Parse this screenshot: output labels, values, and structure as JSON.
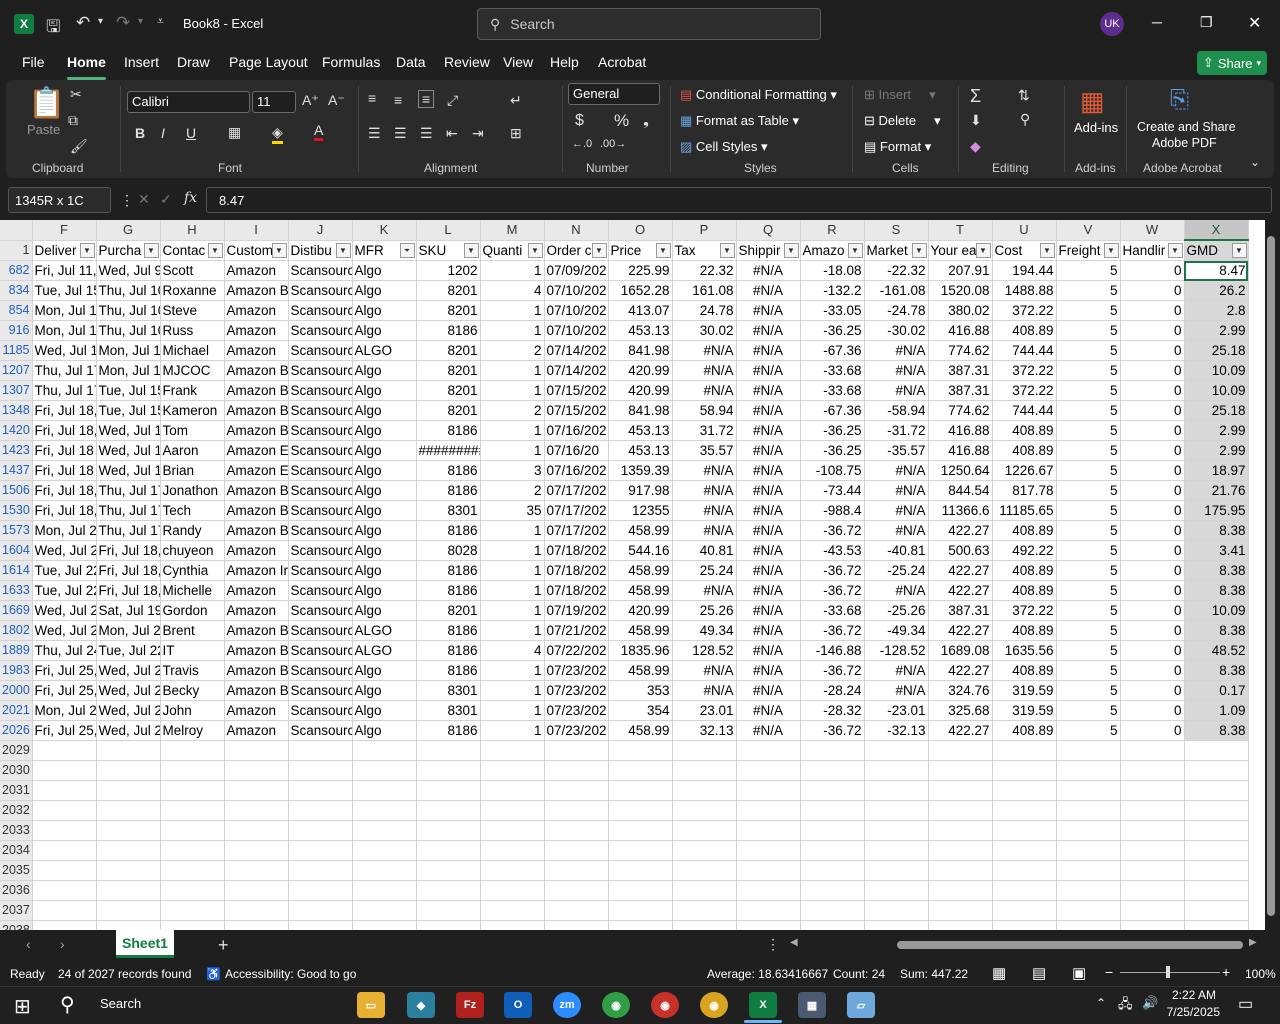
{
  "window": {
    "title": "Book8  -  Excel",
    "search_placeholder": "Search",
    "user_initials": "UK",
    "min": "─",
    "max": "❐",
    "close": "✕"
  },
  "menu": {
    "items": [
      "File",
      "Home",
      "Insert",
      "Draw",
      "Page Layout",
      "Formulas",
      "Data",
      "Review",
      "View",
      "Help",
      "Acrobat"
    ],
    "share": "Share"
  },
  "ribbon": {
    "clipboard": {
      "label": "Clipboard",
      "paste": "Paste"
    },
    "font": {
      "label": "Font",
      "name": "Calibri",
      "size": "11"
    },
    "alignment": {
      "label": "Alignment"
    },
    "number": {
      "label": "Number",
      "format": "General"
    },
    "styles": {
      "label": "Styles",
      "conditional": "Conditional Formatting",
      "format_table": "Format as Table",
      "cell_styles": "Cell Styles"
    },
    "cells": {
      "label": "Cells",
      "insert": "Insert",
      "delete": "Delete",
      "format": "Format"
    },
    "editing": {
      "label": "Editing"
    },
    "addins": {
      "label": "Add-ins",
      "button": "Add-ins"
    },
    "acrobat": {
      "label": "Adobe Acrobat",
      "button1": "Create and Share",
      "button2": "Adobe PDF"
    }
  },
  "formula_bar": {
    "name_box": "1345R x 1C",
    "value": "8.47"
  },
  "sheet": {
    "columns": [
      "F",
      "G",
      "H",
      "I",
      "J",
      "K",
      "L",
      "M",
      "N",
      "O",
      "P",
      "Q",
      "R",
      "S",
      "T",
      "U",
      "V",
      "W",
      "X"
    ],
    "headers": [
      "Deliver",
      "Purcha",
      "Contac",
      "Custom",
      "Distibu",
      "MFR",
      "SKU",
      "Quanti",
      "Order c",
      "Price",
      "Tax",
      "Shippir",
      "Amazo",
      "Market",
      "Your ea",
      "Cost",
      "Freight",
      "Handlir",
      "GMD"
    ],
    "rows": [
      [
        "682",
        "Fri, Jul 11,",
        "Wed, Jul 9",
        "Scott",
        "Amazon",
        "Scansourc",
        "Algo",
        "1202",
        "1",
        "07/09/202",
        "225.99",
        "22.32",
        "#N/A",
        "-18.08",
        "-22.32",
        "207.91",
        "194.44",
        "5",
        "0",
        "8.47"
      ],
      [
        "834",
        "Tue, Jul 15",
        "Thu, Jul 10",
        "Roxanne",
        "Amazon B",
        "Scansourc",
        "Algo",
        "8201",
        "4",
        "07/10/202",
        "1652.28",
        "161.08",
        "#N/A",
        "-132.2",
        "-161.08",
        "1520.08",
        "1488.88",
        "5",
        "0",
        "26.2"
      ],
      [
        "854",
        "Mon, Jul 1",
        "Thu, Jul 10",
        "Steve",
        "Amazon",
        "Scansourc",
        "Algo",
        "8201",
        "1",
        "07/10/202",
        "413.07",
        "24.78",
        "#N/A",
        "-33.05",
        "-24.78",
        "380.02",
        "372.22",
        "5",
        "0",
        "2.8"
      ],
      [
        "916",
        "Mon, Jul 1",
        "Thu, Jul 10",
        "Russ",
        "Amazon",
        "Scansourc",
        "Algo",
        "8186",
        "1",
        "07/10/202",
        "453.13",
        "30.02",
        "#N/A",
        "-36.25",
        "-30.02",
        "416.88",
        "408.89",
        "5",
        "0",
        "2.99"
      ],
      [
        "1185",
        "Wed, Jul 1",
        "Mon, Jul 1",
        "Michael",
        "Amazon",
        "Scansourc",
        "ALGO",
        "8201",
        "2",
        "07/14/202",
        "841.98",
        "#N/A",
        "#N/A",
        "-67.36",
        "#N/A",
        "774.62",
        "744.44",
        "5",
        "0",
        "25.18"
      ],
      [
        "1207",
        "Thu, Jul 17",
        "Mon, Jul 1",
        "MJCOC",
        "Amazon B",
        "Scansourc",
        "Algo",
        "8201",
        "1",
        "07/14/202",
        "420.99",
        "#N/A",
        "#N/A",
        "-33.68",
        "#N/A",
        "387.31",
        "372.22",
        "5",
        "0",
        "10.09"
      ],
      [
        "1307",
        "Thu, Jul 17",
        "Tue, Jul 15",
        "Frank",
        "Amazon B",
        "Scansourc",
        "Algo",
        "8201",
        "1",
        "07/15/202",
        "420.99",
        "#N/A",
        "#N/A",
        "-33.68",
        "#N/A",
        "387.31",
        "372.22",
        "5",
        "0",
        "10.09"
      ],
      [
        "1348",
        "Fri, Jul 18,",
        "Tue, Jul 15",
        "Kameron",
        "Amazon B",
        "Scansourc",
        "Algo",
        "8201",
        "2",
        "07/15/202",
        "841.98",
        "58.94",
        "#N/A",
        "-67.36",
        "-58.94",
        "774.62",
        "744.44",
        "5",
        "0",
        "25.18"
      ],
      [
        "1420",
        "Fri, Jul 18,",
        "Wed, Jul 1",
        "Tom",
        "Amazon B",
        "Scansourc",
        "Algo",
        "8186",
        "1",
        "07/16/202",
        "453.13",
        "31.72",
        "#N/A",
        "-36.25",
        "-31.72",
        "416.88",
        "408.89",
        "5",
        "0",
        "2.99"
      ],
      [
        "1423",
        " Fri, Jul 18",
        " Wed, Jul 1",
        " Aaron",
        " Amazon E",
        " Scansourc",
        " Algo",
        "#########",
        "1",
        " 07/16/20",
        "453.13",
        "35.57",
        "#N/A",
        "-36.25",
        "-35.57",
        "416.88",
        "408.89",
        "5",
        "0",
        "2.99"
      ],
      [
        "1437",
        " Fri, Jul 18",
        " Wed, Jul 1",
        " Brian",
        " Amazon E",
        " Scansourc",
        " Algo",
        "8186",
        "3",
        "07/16/202",
        "1359.39",
        "#N/A",
        "#N/A",
        "-108.75",
        "#N/A",
        "1250.64",
        "1226.67",
        "5",
        "0",
        "18.97"
      ],
      [
        "1506",
        "Fri, Jul 18,",
        "Thu, Jul 17",
        "Jonathon",
        "Amazon B",
        "Scansourc",
        "Algo",
        "8186",
        "2",
        "07/17/202",
        "917.98",
        "#N/A",
        "#N/A",
        "-73.44",
        "#N/A",
        "844.54",
        "817.78",
        "5",
        "0",
        "21.76"
      ],
      [
        "1530",
        "Fri, Jul 18,",
        "Thu, Jul 17",
        "Tech",
        "Amazon B",
        "Scansourc",
        "Algo",
        "8301",
        "35",
        "07/17/202",
        "12355",
        "#N/A",
        "#N/A",
        "-988.4",
        "#N/A",
        "11366.6",
        "11185.65",
        "5",
        "0",
        "175.95"
      ],
      [
        "1573",
        "Mon, Jul 2",
        "Thu, Jul 17",
        "Randy",
        "Amazon B",
        "Scansourc",
        "Algo",
        "8186",
        "1",
        "07/17/202",
        "458.99",
        "#N/A",
        "#N/A",
        "-36.72",
        "#N/A",
        "422.27",
        "408.89",
        "5",
        "0",
        "8.38"
      ],
      [
        "1604",
        "Wed, Jul 2",
        "Fri, Jul 18,",
        "chuyeon",
        "Amazon",
        "Scansourc",
        "Algo",
        "8028",
        "1",
        "07/18/202",
        "544.16",
        "40.81",
        "#N/A",
        "-43.53",
        "-40.81",
        "500.63",
        "492.22",
        "5",
        "0",
        "3.41"
      ],
      [
        "1614",
        "Tue, Jul 22",
        "Fri, Jul 18,",
        "Cynthia",
        "Amazon Ir",
        "Scansourc",
        "Algo",
        "8186",
        "1",
        "07/18/202",
        "458.99",
        "25.24",
        "#N/A",
        "-36.72",
        "-25.24",
        "422.27",
        "408.89",
        "5",
        "0",
        "8.38"
      ],
      [
        "1633",
        "Tue, Jul 22",
        "Fri, Jul 18,",
        "Michelle",
        "Amazon",
        "Scansourc",
        "Algo",
        "8186",
        "1",
        "07/18/202",
        "458.99",
        "#N/A",
        "#N/A",
        "-36.72",
        "#N/A",
        "422.27",
        "408.89",
        "5",
        "0",
        "8.38"
      ],
      [
        "1669",
        "Wed, Jul 2",
        "Sat, Jul 19",
        "Gordon",
        "Amazon",
        "Scansourc",
        "Algo",
        "8201",
        "1",
        "07/19/202",
        "420.99",
        "25.26",
        "#N/A",
        "-33.68",
        "-25.26",
        "387.31",
        "372.22",
        "5",
        "0",
        "10.09"
      ],
      [
        "1802",
        "Wed, Jul 2",
        "Mon, Jul 2",
        "Brent",
        "Amazon B",
        "Scansourc",
        "ALGO",
        "8186",
        "1",
        "07/21/202",
        "458.99",
        "49.34",
        "#N/A",
        "-36.72",
        "-49.34",
        "422.27",
        "408.89",
        "5",
        "0",
        "8.38"
      ],
      [
        "1889",
        "Thu, Jul 24",
        "Tue, Jul 22",
        "IT",
        "Amazon B",
        "Scansourc",
        "ALGO",
        "8186",
        "4",
        "07/22/202",
        "1835.96",
        "128.52",
        "#N/A",
        "-146.88",
        "-128.52",
        "1689.08",
        "1635.56",
        "5",
        "0",
        "48.52"
      ],
      [
        "1983",
        "Fri, Jul 25,",
        "Wed, Jul 2",
        "Travis",
        "Amazon B",
        "Scansourc",
        "Algo",
        "8186",
        "1",
        "07/23/202",
        "458.99",
        "#N/A",
        "#N/A",
        "-36.72",
        "#N/A",
        "422.27",
        "408.89",
        "5",
        "0",
        "8.38"
      ],
      [
        "2000",
        "Fri, Jul 25,",
        "Wed, Jul 2",
        "Becky",
        "Amazon B",
        "Scansourc",
        "Algo",
        "8301",
        "1",
        "07/23/202",
        "353",
        "#N/A",
        "#N/A",
        "-28.24",
        "#N/A",
        "324.76",
        "319.59",
        "5",
        "0",
        "0.17"
      ],
      [
        "2021",
        "Mon, Jul 2",
        "Wed, Jul 2",
        "John",
        "Amazon",
        "Scansourc",
        "Algo",
        "8301",
        "1",
        "07/23/202",
        "354",
        "23.01",
        "#N/A",
        "-28.32",
        "-23.01",
        "325.68",
        "319.59",
        "5",
        "0",
        "1.09"
      ],
      [
        "2026",
        "Fri, Jul 25,",
        "Wed, Jul 2",
        "Melroy",
        "Amazon",
        "Scansourc",
        "Algo",
        "8186",
        "1",
        "07/23/202",
        "458.99",
        "32.13",
        "#N/A",
        "-36.72",
        "-32.13",
        "422.27",
        "408.89",
        "5",
        "0",
        "8.38"
      ]
    ],
    "empty_rows": [
      "2029",
      "2030",
      "2031",
      "2032",
      "2033",
      "2034",
      "2035",
      "2036",
      "2037",
      "2038"
    ],
    "tab": "Sheet1"
  },
  "status": {
    "ready": "Ready",
    "records": "24 of 2027 records found",
    "accessibility": "Accessibility: Good to go",
    "average": "Average: 18.63416667",
    "count": "Count: 24",
    "sum": "Sum: 447.22",
    "zoom": "100%"
  },
  "taskbar": {
    "search": "Search",
    "time": "2:22 AM",
    "date": "7/25/2025"
  }
}
